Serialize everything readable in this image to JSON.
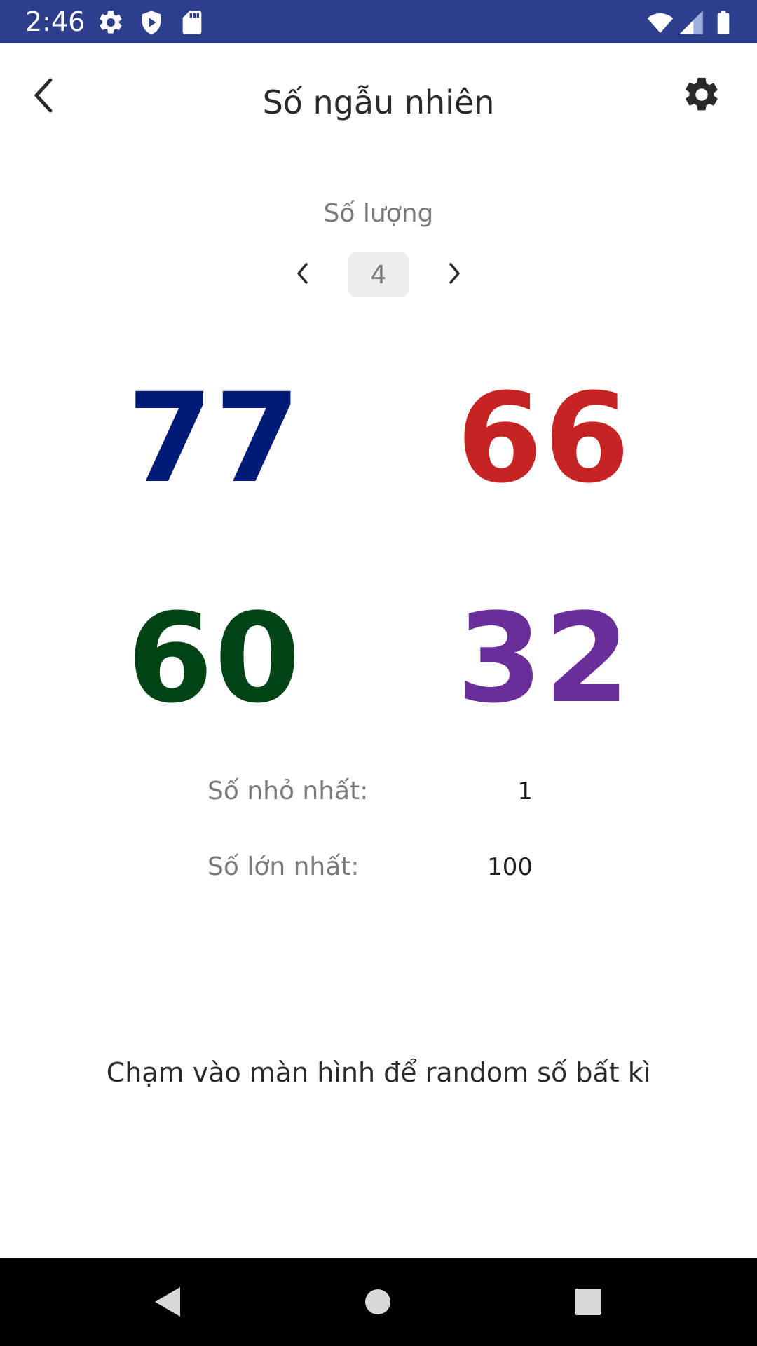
{
  "status_bar": {
    "time": "2:46",
    "background": "#2c3e8c",
    "icons": [
      "gear-icon",
      "shield-play-icon",
      "sd-card-icon",
      "wifi-icon",
      "signal-icon",
      "battery-icon"
    ]
  },
  "app_bar": {
    "title": "Số ngẫu nhiên",
    "back_icon": "chevron-left-icon",
    "settings_icon": "gear-icon"
  },
  "quantity": {
    "label": "Số lượng",
    "value": "4",
    "prev_icon": "chevron-left-icon",
    "next_icon": "chevron-right-icon"
  },
  "numbers": [
    {
      "value": "77",
      "color": "#001a77"
    },
    {
      "value": "66",
      "color": "#c62323"
    },
    {
      "value": "60",
      "color": "#004314"
    },
    {
      "value": "32",
      "color": "#6a2e9b"
    }
  ],
  "range": {
    "min_label": "Số nhỏ nhất:",
    "min_value": "1",
    "max_label": "Số lớn nhất:",
    "max_value": "100"
  },
  "hint": "Chạm vào màn hình để random số bất kì",
  "nav_bar": {
    "icons": [
      "back-triangle-icon",
      "home-circle-icon",
      "recents-square-icon"
    ]
  }
}
